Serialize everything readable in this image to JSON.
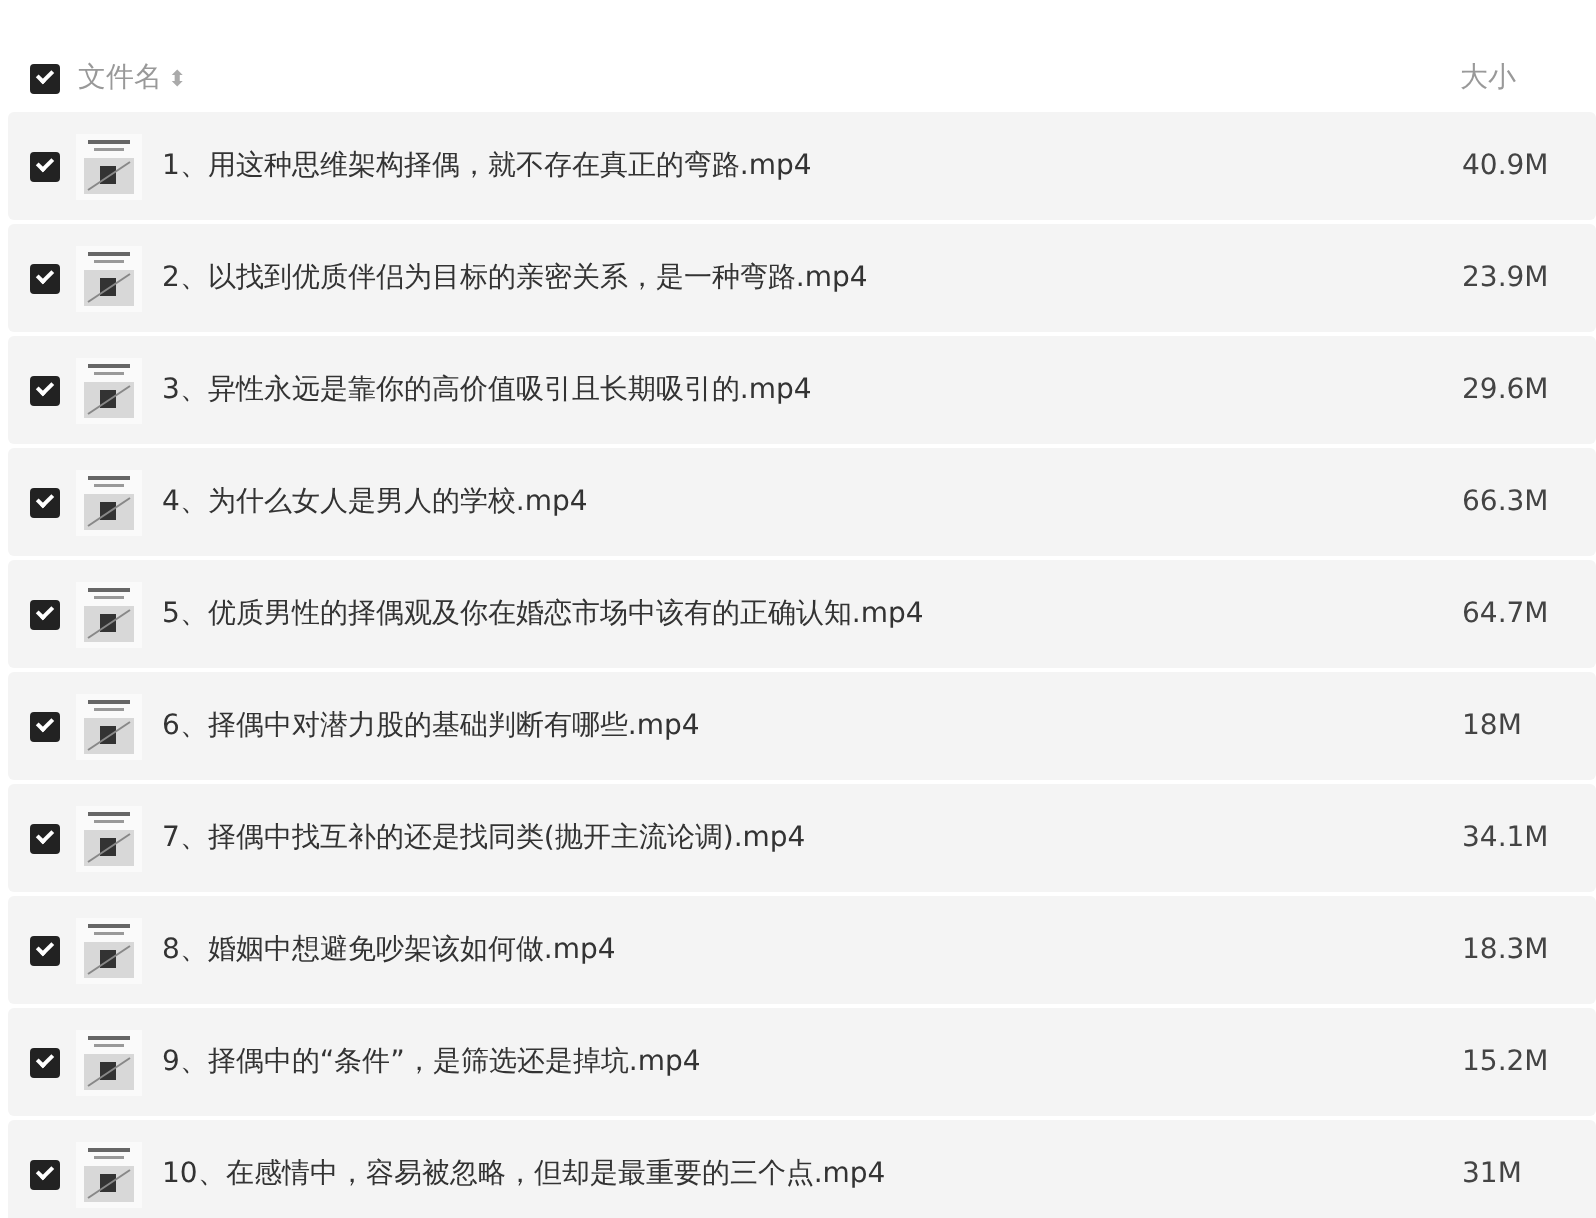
{
  "header": {
    "checked": true,
    "name_label": "文件名",
    "sort_icon": "⬍",
    "size_label": "大小"
  },
  "files": [
    {
      "name": "1、用这种思维架构择偶，就不存在真正的弯路.mp4",
      "size": "40.9M",
      "checked": true
    },
    {
      "name": "2、以找到优质伴侣为目标的亲密关系，是一种弯路.mp4",
      "size": "23.9M",
      "checked": true
    },
    {
      "name": "3、异性永远是靠你的高价值吸引且长期吸引的.mp4",
      "size": "29.6M",
      "checked": true
    },
    {
      "name": "4、为什么女人是男人的学校.mp4",
      "size": "66.3M",
      "checked": true
    },
    {
      "name": "5、优质男性的择偶观及你在婚恋市场中该有的正确认知.mp4",
      "size": "64.7M",
      "checked": true
    },
    {
      "name": "6、择偶中对潜力股的基础判断有哪些.mp4",
      "size": "18M",
      "checked": true
    },
    {
      "name": "7、择偶中找互补的还是找同类(抛开主流论调).mp4",
      "size": "34.1M",
      "checked": true
    },
    {
      "name": "8、婚姻中想避免吵架该如何做.mp4",
      "size": "18.3M",
      "checked": true
    },
    {
      "name": "9、择偶中的“条件”，是筛选还是掉坑.mp4",
      "size": "15.2M",
      "checked": true
    },
    {
      "name": "10、在感情中，容易被忽略，但却是最重要的三个点.mp4",
      "size": "31M",
      "checked": true
    }
  ]
}
